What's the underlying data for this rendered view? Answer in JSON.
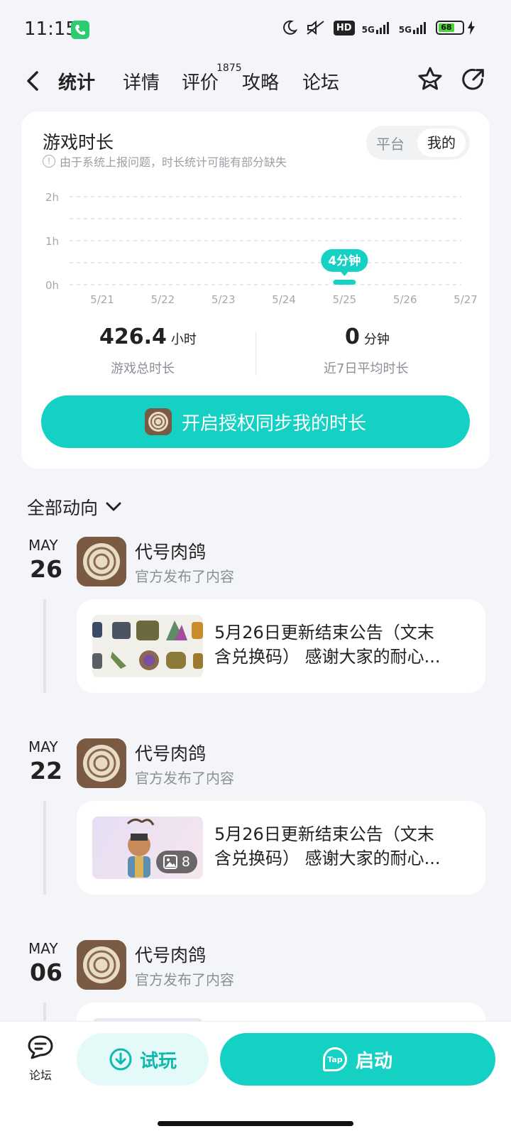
{
  "status_bar": {
    "time": "11:15",
    "hd_label": "HD",
    "network_1": "5G",
    "network_2": "5G",
    "battery": "68"
  },
  "nav": {
    "tabs": [
      {
        "label": "统计"
      },
      {
        "label": "详情"
      },
      {
        "label": "评价"
      },
      {
        "label": "攻略"
      },
      {
        "label": "论坛"
      }
    ],
    "review_count": "1875"
  },
  "playtime": {
    "title": "游戏时长",
    "note": "由于系统上报问题，时长统计可能有部分缺失",
    "toggle": {
      "platform": "平台",
      "mine": "我的"
    },
    "total_value": "426.4",
    "total_unit": "小时",
    "total_label": "游戏总时长",
    "avg_value": "0",
    "avg_unit": "分钟",
    "avg_label": "近7日平均时长",
    "sync_button": "开启授权同步我的时长"
  },
  "chart_data": {
    "type": "bar",
    "categories": [
      "5/21",
      "5/22",
      "5/23",
      "5/24",
      "5/25",
      "5/26",
      "5/27"
    ],
    "values": [
      0,
      0,
      0,
      0,
      4,
      0,
      0
    ],
    "unit": "minutes",
    "y_ticks": [
      "0h",
      "1h",
      "2h"
    ],
    "ylim": [
      0,
      120
    ],
    "highlight_label": "4分钟",
    "highlight_index": 4,
    "grid": true,
    "accent_color": "#14d1c4"
  },
  "feed": {
    "filter_label": "全部动向",
    "items": [
      {
        "month": "MAY",
        "day": "26",
        "author": "代号肉鸽",
        "action": "官方发布了内容",
        "line1": "5月26日更新结束公告（文末",
        "line2": "含兑换码） 感谢大家的耐心...",
        "image_count": ""
      },
      {
        "month": "MAY",
        "day": "22",
        "author": "代号肉鸽",
        "action": "官方发布了内容",
        "line1": "5月26日更新结束公告（文末",
        "line2": "含兑换码） 感谢大家的耐心...",
        "image_count": "8"
      },
      {
        "month": "MAY",
        "day": "06",
        "author": "代号肉鸽",
        "action": "官方发布了内容"
      }
    ]
  },
  "bottom_bar": {
    "forum_label": "论坛",
    "try_label": "试玩",
    "launch_label": "启动",
    "tap_logo": "Tap"
  }
}
